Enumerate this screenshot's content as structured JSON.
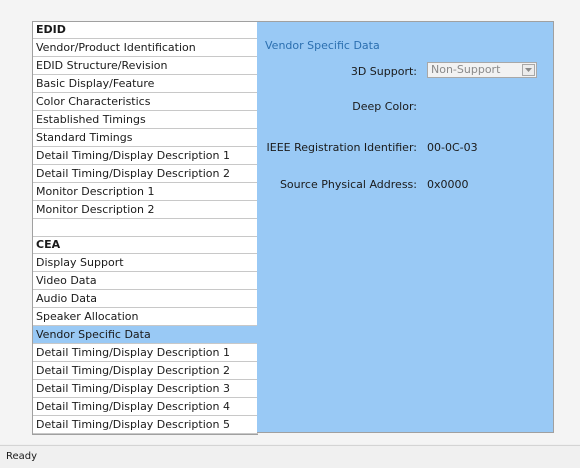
{
  "nav": {
    "edid_header": "EDID",
    "edid_items": [
      "Vendor/Product Identification",
      "EDID Structure/Revision",
      "Basic Display/Feature",
      "Color Characteristics",
      "Established Timings",
      "Standard Timings",
      "Detail Timing/Display Description 1",
      "Detail Timing/Display Description 2",
      "Monitor Description 1",
      "Monitor Description 2"
    ],
    "cea_header": "CEA",
    "cea_items": [
      "Display Support",
      "Video Data",
      "Audio Data",
      "Speaker Allocation",
      "Vendor Specific Data",
      "Detail Timing/Display Description 1",
      "Detail Timing/Display Description 2",
      "Detail Timing/Display Description 3",
      "Detail Timing/Display Description 4",
      "Detail Timing/Display Description 5"
    ],
    "selected": "Vendor Specific Data"
  },
  "detail": {
    "title": "Vendor Specific Data",
    "support_3d_label": "3D Support:",
    "support_3d_value": "Non-Support",
    "deep_color_label": "Deep Color:",
    "ieee_label": "IEEE Registration Identifier:",
    "ieee_value": "00-0C-03",
    "source_addr_label": "Source Physical Address:",
    "source_addr_value": "0x0000"
  },
  "status": {
    "text": "Ready"
  },
  "colors": {
    "selection": "#99c9f5",
    "title": "#2b6fb0"
  }
}
